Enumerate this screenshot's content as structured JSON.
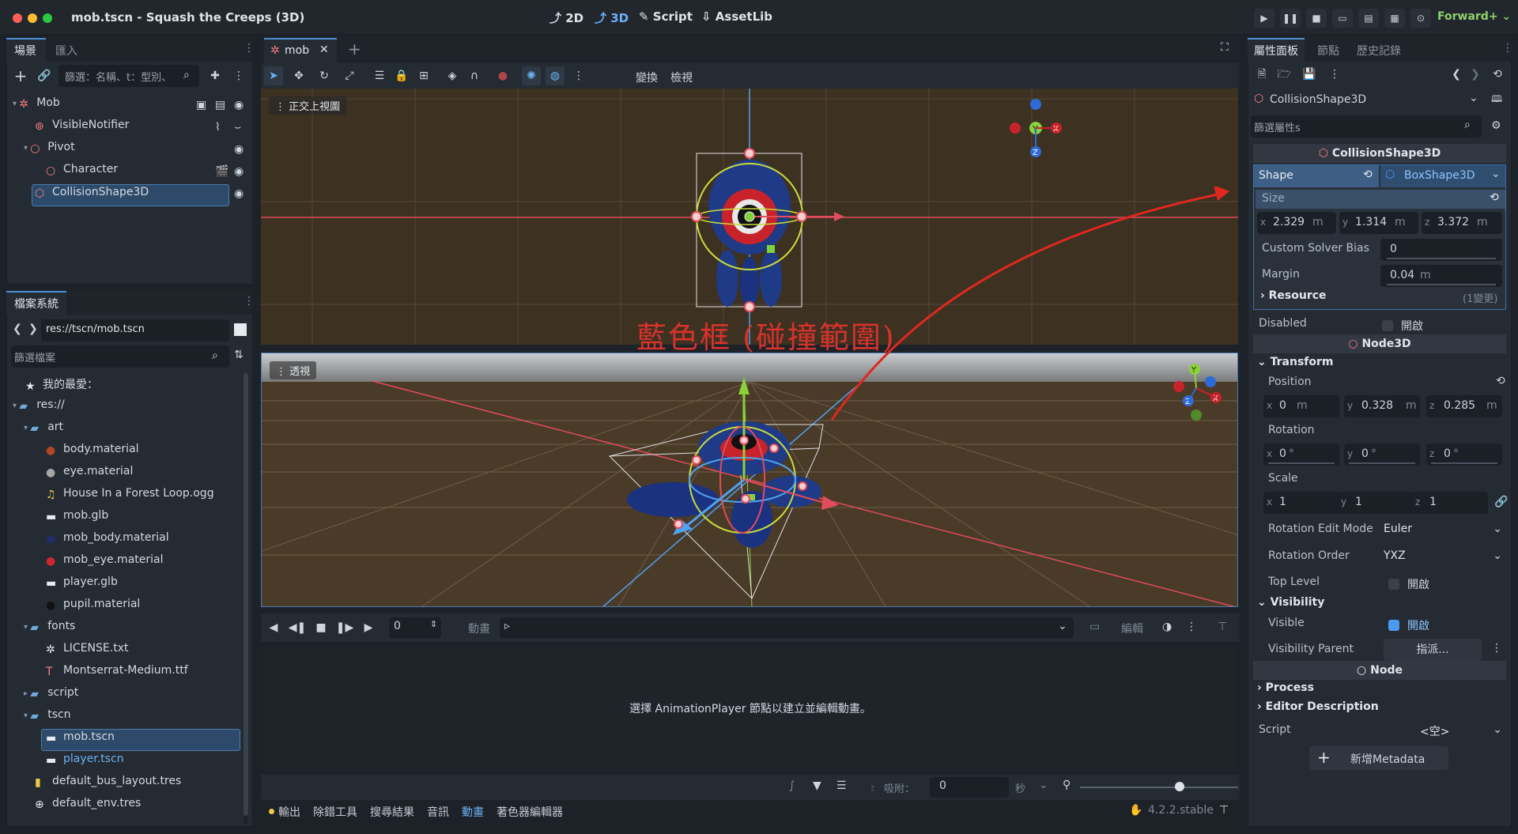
{
  "window": {
    "title": "mob.tscn - Squash the Creeps (3D)"
  },
  "modes": {
    "m2d": "2D",
    "m3d": "3D",
    "script": "Script",
    "assetlib": "AssetLib"
  },
  "renderer": "Forward+",
  "scene_panel": {
    "tab_scene": "場景",
    "tab_import": "匯入",
    "filter_placeholder": "篩選：名稱、t：型別、",
    "nodes": [
      {
        "label": "Mob"
      },
      {
        "label": "VisibleNotifier"
      },
      {
        "label": "Pivot"
      },
      {
        "label": "Character"
      },
      {
        "label": "CollisionShape3D"
      }
    ]
  },
  "fs_panel": {
    "tab": "檔案系統",
    "path": "res://tscn/mob.tscn",
    "filter_placeholder": "篩選檔案",
    "items": [
      {
        "label": "我的最愛："
      },
      {
        "label": "res://"
      },
      {
        "label": "art"
      },
      {
        "label": "body.material"
      },
      {
        "label": "eye.material"
      },
      {
        "label": "House In a Forest Loop.ogg"
      },
      {
        "label": "mob.glb"
      },
      {
        "label": "mob_body.material"
      },
      {
        "label": "mob_eye.material"
      },
      {
        "label": "player.glb"
      },
      {
        "label": "pupil.material"
      },
      {
        "label": "fonts"
      },
      {
        "label": "LICENSE.txt"
      },
      {
        "label": "Montserrat-Medium.ttf"
      },
      {
        "label": "script"
      },
      {
        "label": "tscn"
      },
      {
        "label": "mob.tscn"
      },
      {
        "label": "player.tscn"
      },
      {
        "label": "default_bus_layout.tres"
      },
      {
        "label": "default_env.tres"
      }
    ]
  },
  "editor": {
    "tab": "mob",
    "toolbar_transform": "變換",
    "toolbar_view": "檢視",
    "top_view_label": "正交上視圖",
    "persp_label": "透視",
    "annotation": "藍色框 (碰撞範圍)"
  },
  "anim": {
    "frame": "0",
    "anim_label": "動畫",
    "edit_label": "編輯",
    "hint": "選擇 AnimationPlayer 節點以建立並編輯動畫。",
    "snap_label": "吸附：",
    "snap_value": "0",
    "sec": "秒"
  },
  "bottom_tabs": [
    "輸出",
    "除錯工具",
    "搜尋結果",
    "音訊",
    "動畫",
    "著色器編輯器"
  ],
  "version": "4.2.2.stable",
  "inspector": {
    "tab_inspector": "屬性面板",
    "tab_node": "節點",
    "tab_history": "歷史記錄",
    "object": "CollisionShape3D",
    "filter_placeholder": "篩選屬性s",
    "class_header": "CollisionShape3D",
    "shape_label": "Shape",
    "shape_value": "BoxShape3D",
    "size_label": "Size",
    "size": {
      "x": "2.329",
      "y": "1.314",
      "z": "3.372",
      "unit": "m"
    },
    "solver_label": "Custom Solver Bias",
    "solver_value": "0",
    "margin_label": "Margin",
    "margin_value": "0.04",
    "margin_unit": "m",
    "resource_label": "Resource",
    "resource_changes": "(1變更)",
    "disabled_label": "Disabled",
    "on_label": "開啟",
    "node3d_header": "Node3D",
    "transform_label": "Transform",
    "position_label": "Position",
    "position": {
      "x": "0",
      "y": "0.328",
      "z": "0.285",
      "unit": "m"
    },
    "rotation_label": "Rotation",
    "rotation": {
      "x": "0",
      "y": "0",
      "z": "0",
      "unit": "°"
    },
    "scale_label": "Scale",
    "scale": {
      "x": "1",
      "y": "1",
      "z": "1"
    },
    "rot_edit_label": "Rotation Edit Mode",
    "rot_edit_value": "Euler",
    "rot_order_label": "Rotation Order",
    "rot_order_value": "YXZ",
    "top_level_label": "Top Level",
    "visibility_label": "Visibility",
    "visible_label": "Visible",
    "vis_parent_label": "Visibility Parent",
    "assign_label": "指派...",
    "node_header": "Node",
    "process_label": "Process",
    "editor_desc_label": "Editor Description",
    "script_label": "Script",
    "script_value": "<空>",
    "add_meta": "新增Metadata"
  }
}
